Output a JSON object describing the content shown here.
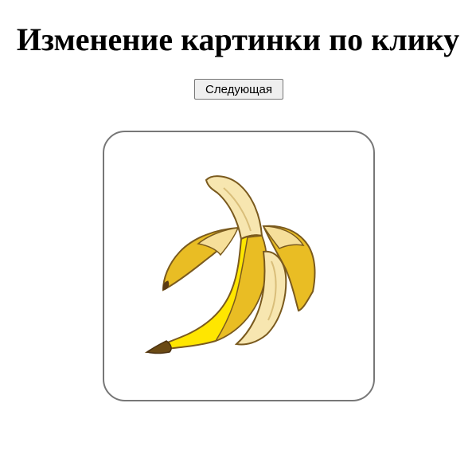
{
  "page": {
    "title": "Изменение картинки по клику"
  },
  "controls": {
    "next_label": "Следующая"
  },
  "image": {
    "alt": "banana",
    "icon": "peeled-banana-icon"
  }
}
